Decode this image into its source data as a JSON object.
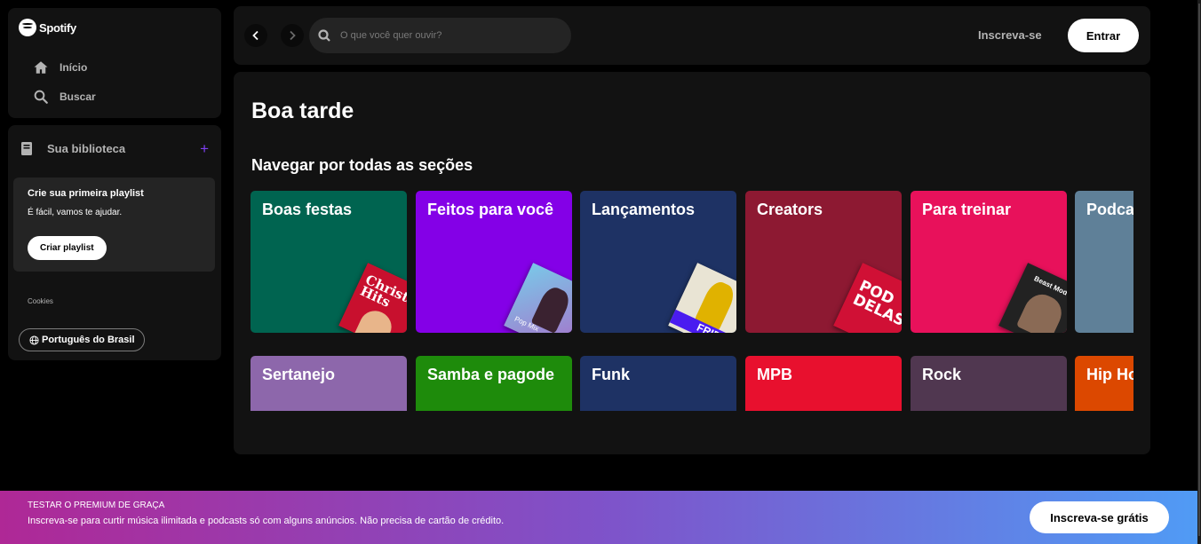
{
  "app": {
    "logo_text": "Spotify"
  },
  "sidebar": {
    "nav": [
      {
        "label": "Início",
        "icon": "home-icon"
      },
      {
        "label": "Buscar",
        "icon": "search-icon"
      }
    ],
    "library": {
      "title": "Sua biblioteca",
      "add_icon": "plus-icon",
      "promo": {
        "title": "Crie sua primeira playlist",
        "subtitle": "É fácil, vamos te ajudar.",
        "button": "Criar playlist"
      },
      "cookies_label": "Cookies",
      "language_button": "Português do Brasil"
    }
  },
  "header": {
    "search_placeholder": "O que você quer ouvir?",
    "signup_label": "Inscreva-se",
    "login_label": "Entrar"
  },
  "main": {
    "greeting": "Boa tarde",
    "section_title": "Navegar por todas as seções",
    "categories_row1": [
      {
        "label": "Boas festas",
        "color": "#006450",
        "art_color": "#c8102e",
        "art_text": "Christmas Hits"
      },
      {
        "label": "Feitos para você",
        "color": "#8400e7",
        "art_color": "#7ac7e8",
        "art_text": "Pop Mix"
      },
      {
        "label": "Lançamentos",
        "color": "#1e3264",
        "art_color": "#e9e4d4",
        "art_text": "FRIDAY"
      },
      {
        "label": "Creators",
        "color": "#8d1932",
        "art_color": "#d01035",
        "art_text": "POD DELAS"
      },
      {
        "label": "Para treinar",
        "color": "#e8115b",
        "art_color": "#222222",
        "art_text": "Beast Mode"
      },
      {
        "label": "Podcasts",
        "color": "#5f8098"
      }
    ],
    "categories_row2": [
      {
        "label": "Sertanejo",
        "color": "#8d67ab"
      },
      {
        "label": "Samba e pagode",
        "color": "#1e8b0b"
      },
      {
        "label": "Funk",
        "color": "#1e3264"
      },
      {
        "label": "MPB",
        "color": "#e8102e"
      },
      {
        "label": "Rock",
        "color": "#503750"
      },
      {
        "label": "Hip Hop",
        "color": "#dc4800"
      }
    ]
  },
  "banner": {
    "eyebrow": "TESTAR O PREMIUM DE GRAÇA",
    "text": "Inscreva-se para curtir música ilimitada e podcasts só com alguns anúncios. Não precisa de cartão de crédito.",
    "button": "Inscreva-se grátis",
    "gradient_start": "#af2896",
    "gradient_end": "#509bf5"
  }
}
